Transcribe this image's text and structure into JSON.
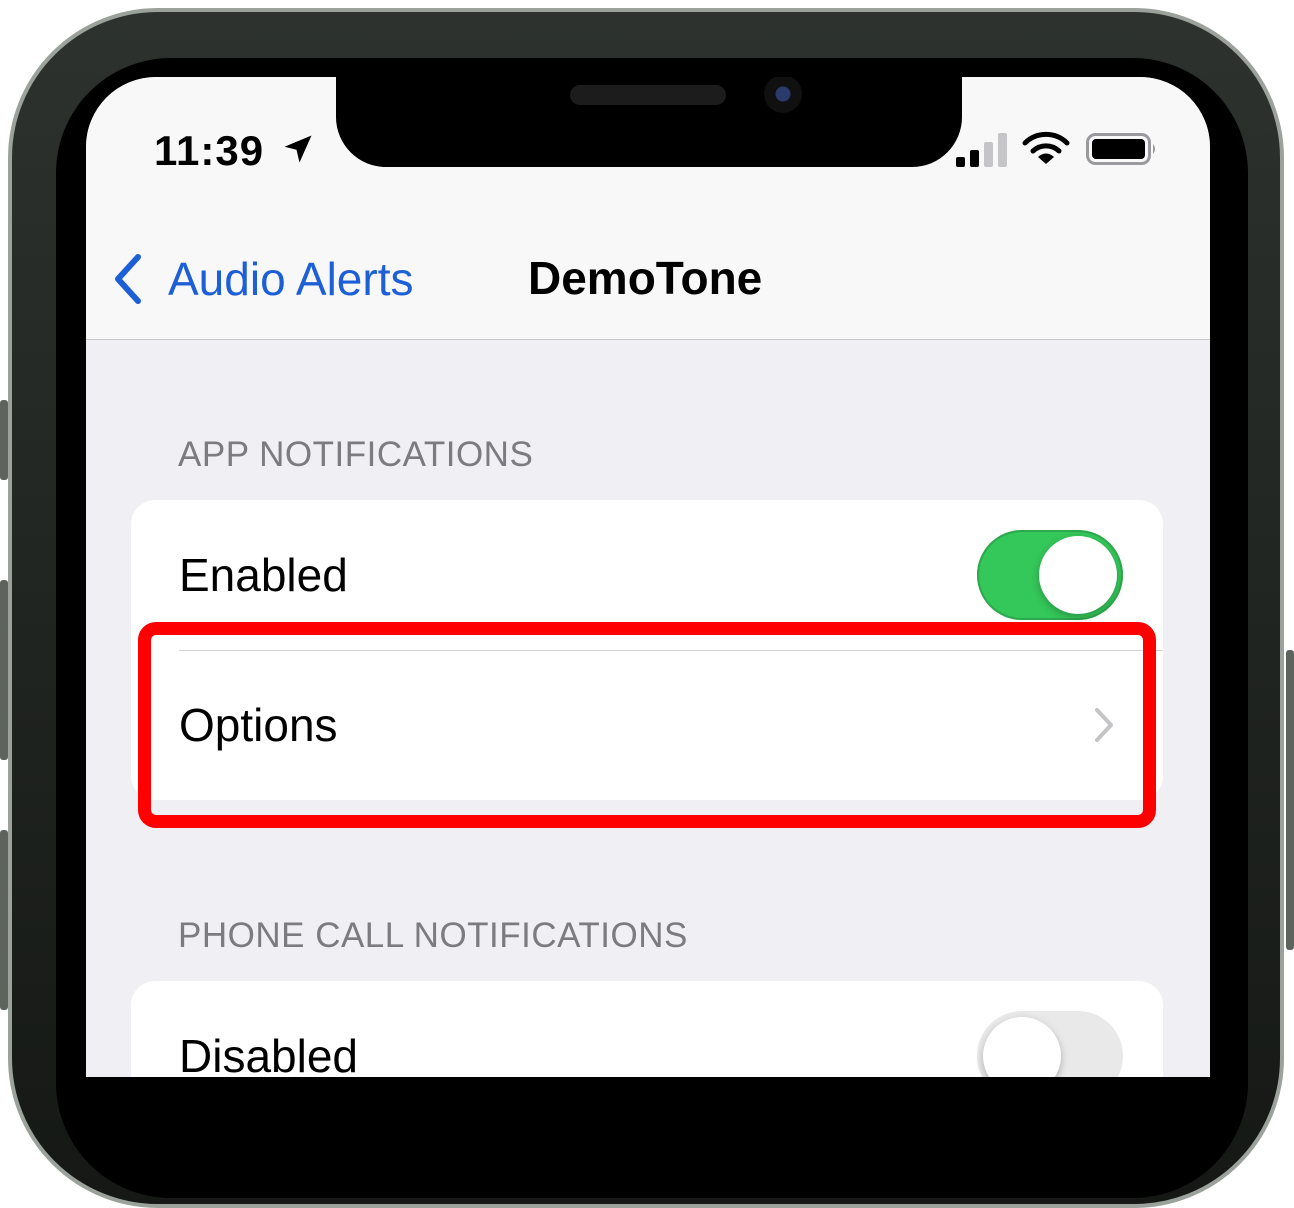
{
  "status_bar": {
    "time": "11:39",
    "icons": [
      "location-arrow-icon",
      "cellular-signal-icon",
      "wifi-icon",
      "battery-icon"
    ]
  },
  "nav": {
    "back_label": "Audio Alerts",
    "title": "DemoTone"
  },
  "sections": {
    "app": {
      "header": "APP NOTIFICATIONS",
      "enabled_label": "Enabled",
      "enabled_on": true,
      "options_label": "Options"
    },
    "phone": {
      "header": "PHONE CALL NOTIFICATIONS",
      "row_label": "Disabled",
      "row_on": false
    }
  },
  "colors": {
    "accent": "#1c5fd6",
    "toggle_on": "#34c759",
    "highlight": "#ff0000",
    "background": "#efeff4"
  }
}
